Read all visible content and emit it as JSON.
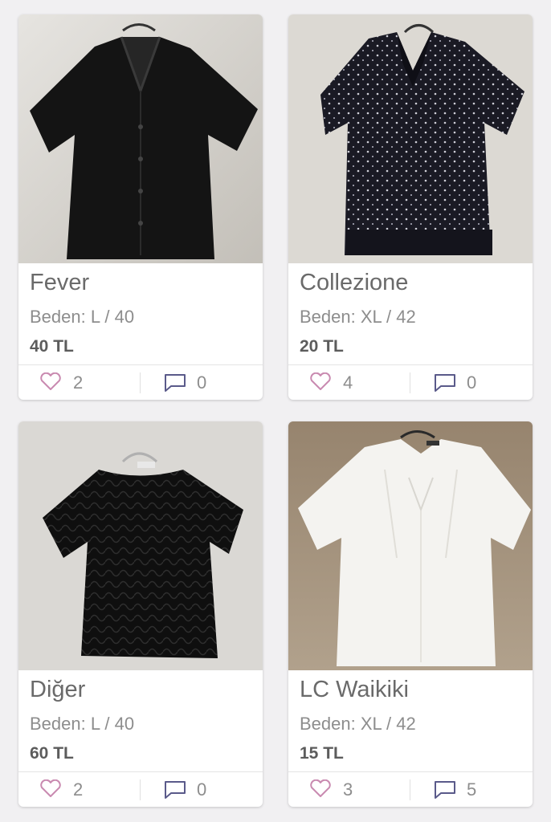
{
  "products": [
    {
      "brand": "Fever",
      "size": "Beden: L / 40",
      "price": "40 TL",
      "likes": "2",
      "comments": "0",
      "image": "black-lace-blouse-photo",
      "bg": "#d9d6d0",
      "garment": "#141414"
    },
    {
      "brand": "Collezione",
      "size": "Beden: XL / 42",
      "price": "20 TL",
      "likes": "4",
      "comments": "0",
      "image": "black-polka-dot-blouse-photo",
      "bg": "#dcd9d3",
      "garment": "#1a1a24"
    },
    {
      "brand": "Diğer",
      "size": "Beden: L / 40",
      "price": "60 TL",
      "likes": "2",
      "comments": "0",
      "image": "black-ruffled-top-photo",
      "bg": "#dad8d4",
      "garment": "#0f0f0f"
    },
    {
      "brand": "LC Waikiki",
      "size": "Beden: XL / 42",
      "price": "15 TL",
      "likes": "3",
      "comments": "5",
      "image": "white-peasant-blouse-photo",
      "bg": "#a08e78",
      "garment": "#f4f3f0"
    }
  ],
  "colors": {
    "heart": "#c98ab0",
    "comment": "#5a5a8a",
    "text": "#6a6a6a"
  },
  "icons": {
    "like": "heart-icon",
    "comment": "comment-icon"
  }
}
